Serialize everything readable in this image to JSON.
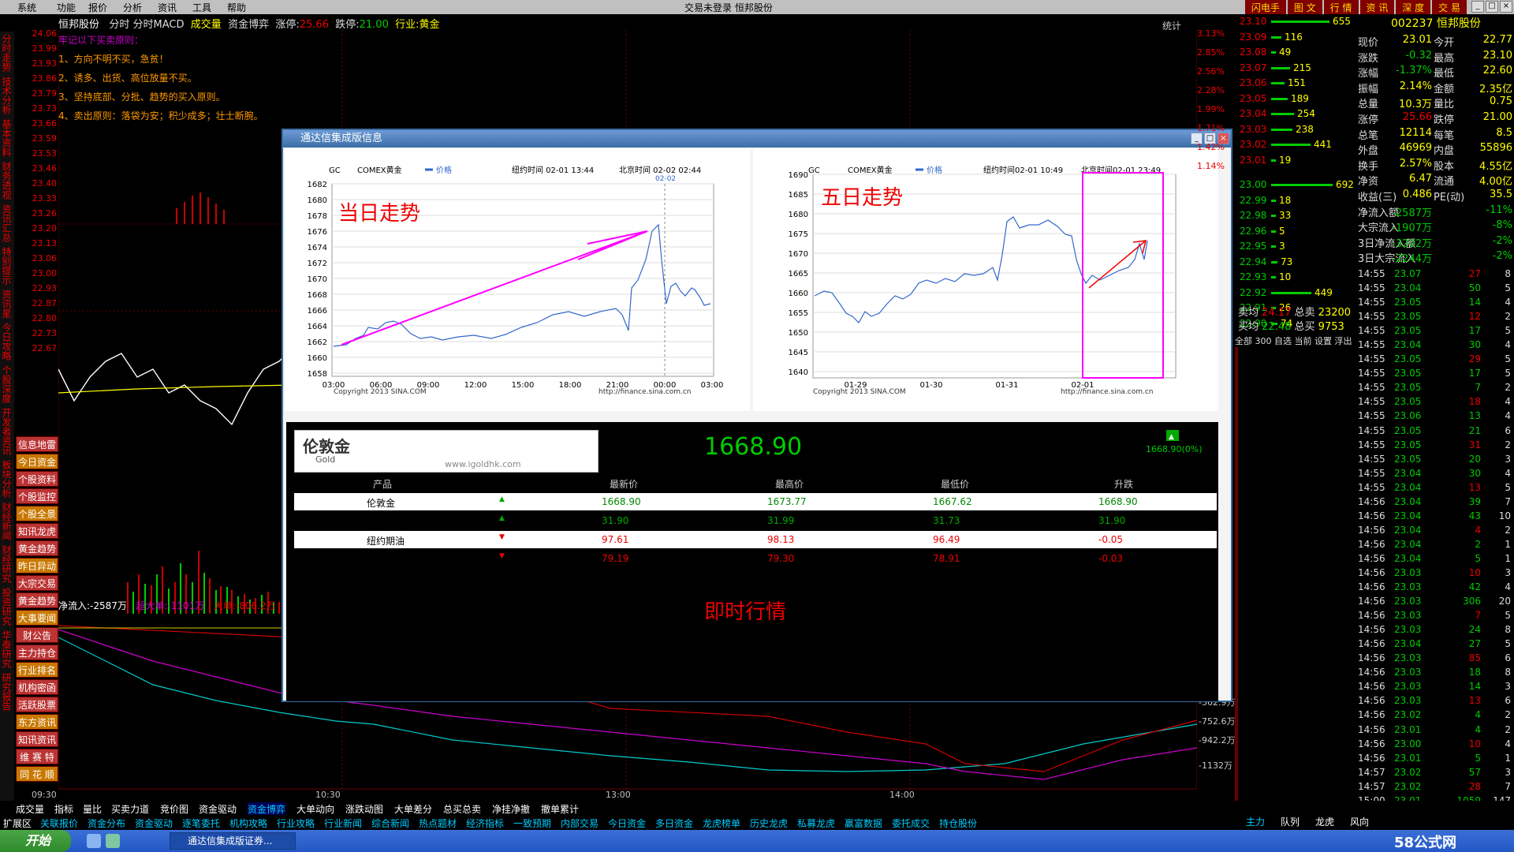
{
  "menu": [
    "系统",
    "功能",
    "报价",
    "分析",
    "资讯",
    "工具",
    "帮助"
  ],
  "menu_center": "交易未登录  恒邦股份",
  "top_buttons": [
    "闪电手",
    "图 文",
    "行 情",
    "资 讯",
    "深 度",
    "交 易"
  ],
  "header": {
    "stock": "恒邦股份",
    "tabs": "分时  分时MACD",
    "vol_label": "成交量",
    "chip": "资金博弈",
    "zhangting_label": "涨停:",
    "zhangting": "25.66",
    "dieting_label": "跌停:",
    "dieting": "21.00",
    "industry": "行业:黄金",
    "tongji": "统计"
  },
  "side_vertical": [
    "分时走势",
    "技术分析",
    "基本资料",
    "财务透视",
    "资讯汇总",
    "特别提示",
    "资讯星",
    "今日攻略",
    "个股深度",
    "开发者资讯",
    "板块分析",
    "财经新闻",
    "财经研究",
    "投资研究",
    "华泰研究",
    "研究报告"
  ],
  "side_buttons": [
    "信息地雷",
    "今日资金",
    "个股资料",
    "个股监控",
    "个股全景",
    "知讯龙虎",
    "黄金趋势",
    "昨日异动",
    "大宗交易",
    "黄金趋势",
    "大事要闻",
    "财公告",
    "主力持仓",
    "行业排名",
    "机构密函",
    "活跃股票",
    "东方资讯",
    "知讯资讯",
    "维 赛 特",
    "同 花 顺"
  ],
  "price_axis": [
    "24.06",
    "23.99",
    "23.93",
    "23.86",
    "23.79",
    "23.73",
    "23.66",
    "23.59",
    "23.53",
    "23.46",
    "23.40",
    "23.33",
    "23.26",
    "23.20",
    "23.13",
    "23.06",
    "23.00",
    "22.93",
    "22.87",
    "22.80",
    "22.73",
    "22.67"
  ],
  "pct_axis": [
    "3.13%",
    "2.85%",
    "2.56%",
    "2.28%",
    "1.99%",
    "1.71%",
    "1.42%",
    "1.14%"
  ],
  "tips": [
    "牢记以下买卖原则：",
    "1、方向不明不买，急贫！",
    "2、诱多、出货、高位放量不买。",
    "3、坚持底部、分批、趋势的买入原则。",
    "4、卖出原则：落袋为安；积少成多；壮士断腕。"
  ],
  "net_flow": {
    "a": "净流入:-2587万",
    "b": "超大单:-1101万",
    "c": "大单:-806.2万"
  },
  "flow_axis": [
    "-562.9万",
    "-752.6万",
    "-942.2万",
    "-1132万"
  ],
  "time_axis": [
    "09:30",
    "10:30",
    "13:00",
    "14:00"
  ],
  "dialog": {
    "title": "通达信集成版信息",
    "c1": {
      "sym": "GC",
      "ex": "COMEX黄金",
      "leg": "价格",
      "ny": "纽约时间 02-01 13:44",
      "bj": "北京时间 02-02 02:44",
      "mk": "02-02",
      "yticks": [
        "1682",
        "1680",
        "1678",
        "1676",
        "1674",
        "1672",
        "1670",
        "1668",
        "1666",
        "1664",
        "1662",
        "1660",
        "1658"
      ],
      "xticks": [
        "03:00",
        "06:00",
        "09:00",
        "12:00",
        "15:00",
        "18:00",
        "21:00",
        "00:00",
        "03:00"
      ],
      "copy": "Copyright 2013 SINA.COM",
      "url": "http://finance.sina.com.cn",
      "label": "当日走势"
    },
    "c2": {
      "sym": "GC",
      "ex": "COMEX黄金",
      "leg": "价格",
      "ny": "纽约时间02-01 10:49",
      "bj": "北京时间02-01 23:49",
      "yticks": [
        "1690",
        "1685",
        "1680",
        "1675",
        "1670",
        "1665",
        "1660",
        "1655",
        "1650",
        "1645",
        "1640"
      ],
      "xticks": [
        "01-29",
        "01-30",
        "01-31",
        "02-01"
      ],
      "copy": "Copyright 2013 SINA.COM",
      "url": "http://finance.sina.com.cn",
      "label": "五日走势"
    },
    "logo": "伦敦金",
    "logo_sub": "Gold",
    "site": "www.igoldhk.com",
    "big": "1668.90",
    "bigsub": "1668.90(0%)",
    "cols": [
      "产品",
      "最新价",
      "最高价",
      "最低价",
      "升跌"
    ],
    "rows": [
      [
        "伦敦金",
        "1668.90",
        "1673.77",
        "1667.62",
        "1668.90"
      ],
      [
        "",
        "31.90",
        "31.99",
        "31.73",
        "31.90"
      ],
      [
        "纽约期油",
        "97.61",
        "98.13",
        "96.49",
        "-0.05"
      ],
      [
        "",
        "79.19",
        "79.30",
        "78.91",
        "-0.03"
      ]
    ],
    "bottom_label": "即时行情"
  },
  "orderbook": [
    [
      "23.10",
      "655"
    ],
    [
      "23.09",
      "116"
    ],
    [
      "23.08",
      "49"
    ],
    [
      "23.07",
      "215"
    ],
    [
      "23.06",
      "151"
    ],
    [
      "23.05",
      "189"
    ],
    [
      "23.04",
      "254"
    ],
    [
      "23.03",
      "238"
    ],
    [
      "23.02",
      "441"
    ],
    [
      "23.01",
      "19"
    ],
    [
      "23.00",
      "692"
    ],
    [
      "22.99",
      "18"
    ],
    [
      "22.98",
      "33"
    ],
    [
      "22.96",
      "5"
    ],
    [
      "22.95",
      "3"
    ],
    [
      "22.94",
      "73"
    ],
    [
      "22.93",
      "10"
    ],
    [
      "22.92",
      "449"
    ],
    [
      "22.91",
      "26"
    ],
    [
      "22.90",
      "74"
    ]
  ],
  "avg": {
    "sell_label": "卖均",
    "sell": "24.17",
    "tsell_label": "总卖",
    "tsell": "23200",
    "buy_label": "买均",
    "buy": "22.48",
    "tbuy_label": "总买",
    "tbuy": "9753"
  },
  "subtabs": "全部  300  自选  当前  设置  浮出",
  "stock_code": "002237 恒邦股份",
  "quote": [
    [
      "现价",
      "23.01",
      "今开",
      "22.77"
    ],
    [
      "涨跌",
      "-0.32",
      "最高",
      "23.10"
    ],
    [
      "涨幅",
      "-1.37%",
      "最低",
      "22.60"
    ],
    [
      "振幅",
      "2.14%",
      "金额",
      "2.35亿"
    ],
    [
      "总量",
      "10.3万",
      "量比",
      "0.75"
    ],
    [
      "涨停",
      "25.66",
      "跌停",
      "21.00"
    ],
    [
      "总笔",
      "12114",
      "每笔",
      "8.5"
    ],
    [
      "外盘",
      "46969",
      "内盘",
      "55896"
    ],
    [
      "换手",
      "2.57%",
      "股本",
      "4.55亿"
    ],
    [
      "净资",
      "6.47",
      "流通",
      "4.00亿"
    ],
    [
      "收益(三)",
      "0.486",
      "PE(动)",
      "35.5"
    ],
    [
      "净流入额",
      "-2587万",
      "",
      "-11%"
    ],
    [
      "大宗流入",
      "-1907万",
      "",
      "-8%"
    ],
    [
      "3日净流入额",
      "-3202万",
      "",
      "-2%"
    ],
    [
      "3日大宗流入",
      "-2244万",
      "",
      "-2%"
    ]
  ],
  "ticks": [
    [
      "14:55",
      "23.07",
      "27",
      "8"
    ],
    [
      "14:55",
      "23.04",
      "50",
      "5"
    ],
    [
      "14:55",
      "23.05",
      "14",
      "4"
    ],
    [
      "14:55",
      "23.05",
      "12",
      "2"
    ],
    [
      "14:55",
      "23.05",
      "17",
      "5"
    ],
    [
      "14:55",
      "23.04",
      "30",
      "4"
    ],
    [
      "14:55",
      "23.05",
      "29",
      "5"
    ],
    [
      "14:55",
      "23.05",
      "17",
      "5"
    ],
    [
      "14:55",
      "23.05",
      "7",
      "2"
    ],
    [
      "14:55",
      "23.05",
      "18",
      "4"
    ],
    [
      "14:55",
      "23.06",
      "13",
      "4"
    ],
    [
      "14:55",
      "23.05",
      "21",
      "6"
    ],
    [
      "14:55",
      "23.05",
      "31",
      "2"
    ],
    [
      "14:55",
      "23.05",
      "20",
      "3"
    ],
    [
      "14:55",
      "23.04",
      "30",
      "4"
    ],
    [
      "14:55",
      "23.04",
      "13",
      "5"
    ],
    [
      "14:56",
      "23.04",
      "39",
      "7"
    ],
    [
      "14:56",
      "23.04",
      "43",
      "10"
    ],
    [
      "14:56",
      "23.04",
      "4",
      "2"
    ],
    [
      "14:56",
      "23.04",
      "2",
      "1"
    ],
    [
      "14:56",
      "23.04",
      "5",
      "1"
    ],
    [
      "14:56",
      "23.03",
      "10",
      "3"
    ],
    [
      "14:56",
      "23.03",
      "42",
      "4"
    ],
    [
      "14:56",
      "23.03",
      "306",
      "20"
    ],
    [
      "14:56",
      "23.03",
      "7",
      "5"
    ],
    [
      "14:56",
      "23.03",
      "24",
      "8"
    ],
    [
      "14:56",
      "23.04",
      "27",
      "5"
    ],
    [
      "14:56",
      "23.03",
      "85",
      "6"
    ],
    [
      "14:56",
      "23.03",
      "18",
      "8"
    ],
    [
      "14:56",
      "23.03",
      "14",
      "3"
    ],
    [
      "14:56",
      "23.03",
      "13",
      "6"
    ],
    [
      "14:56",
      "23.02",
      "4",
      "2"
    ],
    [
      "14:56",
      "23.01",
      "4",
      "2"
    ],
    [
      "14:56",
      "23.00",
      "10",
      "4"
    ],
    [
      "14:56",
      "23.01",
      "5",
      "1"
    ],
    [
      "14:57",
      "23.02",
      "57",
      "3"
    ],
    [
      "14:57",
      "23.02",
      "28",
      "7"
    ],
    [
      "15:00",
      "23.01",
      "1059",
      "147"
    ]
  ],
  "bottom_tabs1": [
    "成交量",
    "指标",
    "量比",
    "买卖力道",
    "竞价图",
    "资金驱动",
    "资金博弈",
    "大单动向",
    "涨跌动图",
    "大单差分",
    "总买总卖",
    "净挂净撤",
    "撤单累计"
  ],
  "bottom_tabs2": [
    "扩展区",
    "关联报价",
    "资金分布",
    "资金驱动",
    "逐笔委托",
    "机构攻略",
    "行业攻略",
    "行业新闻",
    "综合新闻",
    "热点题材",
    "经济指标",
    "一致预期",
    "内部交易",
    "今日资金",
    "多日资金",
    "龙虎榜单",
    "历史龙虎",
    "私募龙虎",
    "赢富数据",
    "委托成交",
    "持仓股份"
  ],
  "right_bottom_tabs": [
    "主力",
    "队列",
    "龙虎",
    "风向"
  ],
  "taskbar": {
    "start": "开始",
    "task": "通达信集成版证券...",
    "brand": "58公式网"
  }
}
